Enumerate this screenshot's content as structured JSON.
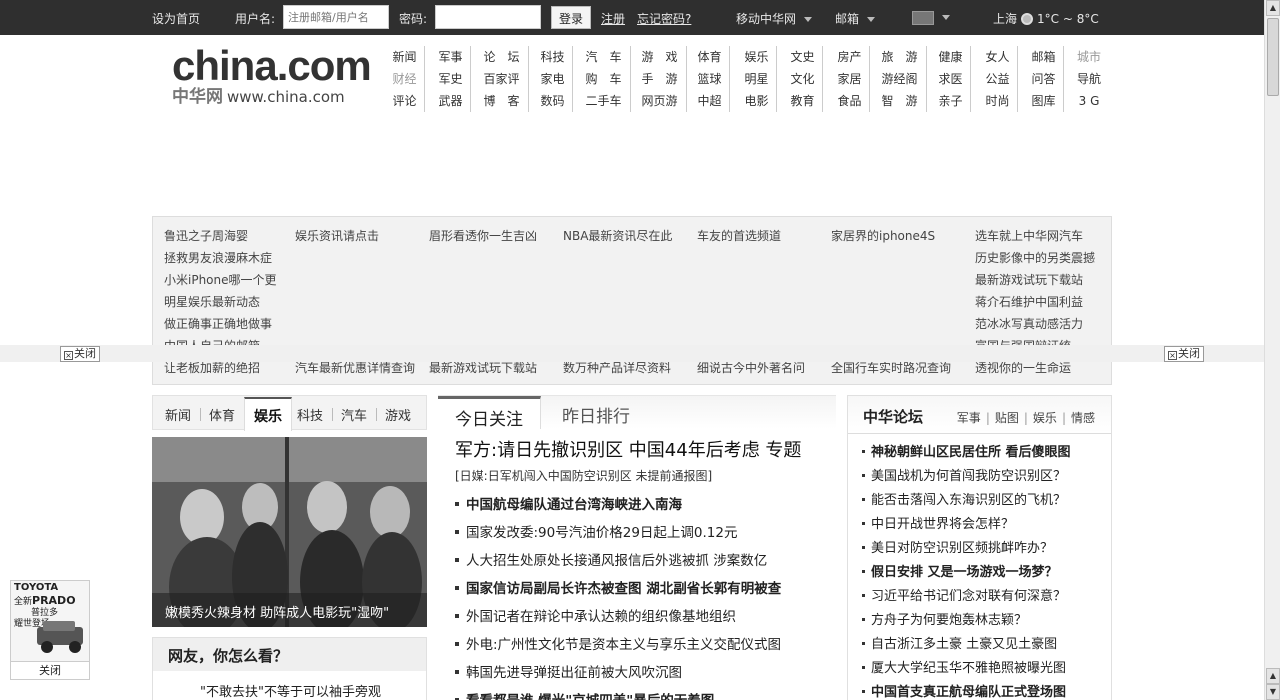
{
  "topbar": {
    "set_home": "设为首页",
    "username_label": "用户名:",
    "username_placeholder": "注册邮箱/用户名",
    "password_label": "密码:",
    "login_button": "登录",
    "register_link": "注册",
    "forgot_link": "忘记密码?",
    "mobile_menu": "移动中华网",
    "mail_menu": "邮箱",
    "city": "上海",
    "weather": "1°C ~ 8°C"
  },
  "logo": {
    "main": "china.com",
    "cn": "中华网",
    "url": "www.china.com"
  },
  "nav": {
    "columns": [
      [
        "新闻",
        "财经",
        "评论"
      ],
      [
        "军事",
        "军史",
        "武器"
      ],
      [
        "论　坛",
        "百家评",
        "博　客"
      ],
      [
        "科技",
        "家电",
        "数码"
      ],
      [
        "汽　车",
        "购　车",
        "二手车"
      ],
      [
        "游　戏",
        "手　游",
        "网页游"
      ],
      [
        "体育",
        "篮球",
        "中超"
      ],
      [
        "娱乐",
        "明星",
        "电影"
      ],
      [
        "文史",
        "文化",
        "教育"
      ],
      [
        "房产",
        "家居",
        "食品"
      ],
      [
        "旅　游",
        "游经阁",
        "智　游"
      ],
      [
        "健康",
        "求医",
        "亲子"
      ],
      [
        "女人",
        "公益",
        "时尚"
      ],
      [
        "邮箱",
        "问答",
        "图库"
      ],
      [
        "城市",
        "导航",
        "3 G"
      ]
    ]
  },
  "adbox": {
    "col1": [
      "鲁迅之子周海婴",
      "拯救男友浪漫麻木症",
      "小米iPhone哪一个更",
      "明星娱乐最新动态",
      "做正确事正确地做事",
      "中国人自己的邮箱",
      "让老板加薪的绝招"
    ],
    "row1": [
      "娱乐资讯请点击",
      "眉形看透你一生吉凶",
      "NBA最新资讯尽在此",
      "车友的首选频道",
      "家居界的iphone4S"
    ],
    "row7": [
      "汽车最新优惠详情查询",
      "最新游戏试玩下载站",
      "数万种产品详尽资料",
      "细说古今中外著名问",
      "全国行车实时路况查询"
    ],
    "col7": [
      "选车就上中华网汽车",
      "历史影像中的另类震撼",
      "最新游戏试玩下载站",
      "蒋介石维护中国利益",
      "范冰冰写真动感活力",
      "富国与强国辩证统一",
      "透视你的一生命运"
    ]
  },
  "side_close": "关闭",
  "left": {
    "tabs": [
      "新闻",
      "体育",
      "娱乐",
      "科技",
      "汽车",
      "游戏"
    ],
    "active_tab": "娱乐",
    "photo_caption": "嫩模秀火辣身材 助阵成人电影玩\"湿吻\"",
    "ask_title": "网友，你怎么看？",
    "ask_question": "\"不敢去扶\"不等于可以袖手旁观"
  },
  "middle": {
    "tab_active": "今日关注",
    "tab_other": "昨日排行",
    "headline": "军方:请日先撤识别区 中国44年后考虑 专题",
    "subhead": "[日媒:日军机闯入中国防空识别区 未提前通报图]",
    "news": [
      {
        "text": "中国航母编队通过台湾海峡进入南海",
        "bold": true
      },
      {
        "text": "国家发改委:90号汽油价格29日起上调0.12元",
        "bold": false
      },
      {
        "text": "人大招生处原处长接通风报信后外逃被抓 涉案数亿",
        "bold": false
      },
      {
        "text": "国家信访局副局长许杰被查图 湖北副省长郭有明被查",
        "bold": true
      },
      {
        "text": "外国记者在辩论中承认达赖的组织像基地组织",
        "bold": false
      },
      {
        "text": "外电:广州性文化节是资本主义与享乐主义交配仪式图",
        "bold": false
      },
      {
        "text": "韩国先进导弹挺出征前被大风吹沉图",
        "bold": false
      },
      {
        "text": "看看都是谁 爆光\"京城四美\"暴后的无着图",
        "bold": true
      }
    ]
  },
  "right": {
    "title": "中华论坛",
    "links": [
      "军事",
      "贴图",
      "娱乐",
      "情感"
    ],
    "items": [
      {
        "text": "神秘朝鲜山区民居住所 看后傻眼图",
        "bold": true
      },
      {
        "text": "美国战机为何首闯我防空识别区？",
        "bold": false
      },
      {
        "text": "能否击落闯入东海识别区的飞机？",
        "bold": false
      },
      {
        "text": "中日开战世界将会怎样？",
        "bold": false
      },
      {
        "text": "美日对防空识别区频挑衅咋办？",
        "bold": false
      },
      {
        "text": "假日安排 又是一场游戏一场梦？",
        "bold": true
      },
      {
        "text": "习近平给书记们念对联有何深意？",
        "bold": false
      },
      {
        "text": "方舟子为何要炮轰林志颖？",
        "bold": false
      },
      {
        "text": "自古浙江多土豪 土豪又见土豪图",
        "bold": false
      },
      {
        "text": "厦大大学纪玉华不雅艳照被曝光图",
        "bold": false
      },
      {
        "text": "中国首支真正航母编队正式登场图",
        "bold": true
      }
    ]
  },
  "car_ad": {
    "brand": "TOYOTA",
    "line1": "全新",
    "model": "PRADO",
    "cn_name": "普拉多",
    "slogan": "耀世登场",
    "close": "关闭"
  }
}
